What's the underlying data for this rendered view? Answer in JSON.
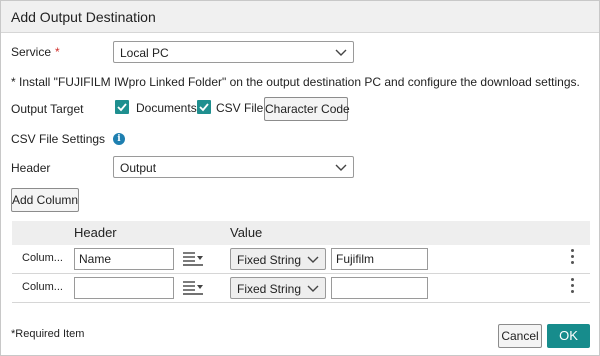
{
  "dialog": {
    "title": "Add Output Destination"
  },
  "service": {
    "label": "Service",
    "required_mark": "*",
    "value": "Local PC"
  },
  "install_note": "* Install \"FUJIFILM IWpro Linked Folder\" on the output destination PC and configure the download settings.",
  "output_target": {
    "label": "Output Target",
    "documents_label": "Documents",
    "documents_checked": true,
    "csv_label": "CSV File",
    "csv_checked": true,
    "character_code_button": "Character Code"
  },
  "csv_settings": {
    "label": "CSV File Settings",
    "info_icon": "i"
  },
  "header_setting": {
    "label": "Header",
    "value": "Output"
  },
  "add_column_button": "Add Column",
  "table": {
    "header_col": "Header",
    "value_col": "Value",
    "rows": [
      {
        "name": "Colum...",
        "header_value": "Name",
        "type": "Fixed String",
        "value": "Fujifilm"
      },
      {
        "name": "Colum...",
        "header_value": "",
        "type": "Fixed String",
        "value": ""
      }
    ]
  },
  "footer": {
    "required_note": "*Required Item",
    "cancel": "Cancel",
    "ok": "OK"
  },
  "colors": {
    "accent": "#178c8c",
    "checkbox": "#1f8f8f",
    "required": "#d0302c",
    "info": "#1e7fb0"
  },
  "icons": {
    "dropdown": "chevron-down-icon",
    "check": "check-icon",
    "info": "info-icon",
    "format": "text-format-icon",
    "more": "more-vertical-icon"
  }
}
